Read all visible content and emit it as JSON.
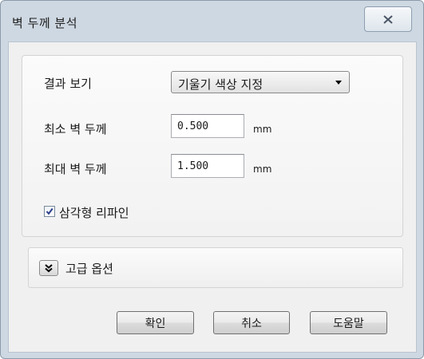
{
  "window": {
    "title": "벽 두께 분석"
  },
  "icons": {
    "close": "close-icon",
    "dropdown": "chevron-down-icon",
    "expander": "double-chevron-down-icon",
    "check": "checkmark-icon"
  },
  "form": {
    "view_result_label": "결과 보기",
    "view_result_selected": "기울기 색상 지정",
    "min_thickness_label": "최소 벽 두께",
    "min_thickness_value": "0.500",
    "min_thickness_unit": "mm",
    "max_thickness_label": "최대 벽 두께",
    "max_thickness_value": "1.500",
    "max_thickness_unit": "mm",
    "triangle_refine_label": "삼각형 리파인",
    "triangle_refine_checked": true
  },
  "advanced": {
    "label": "고급 옵션"
  },
  "buttons": {
    "ok": "확인",
    "cancel": "취소",
    "help": "도움말"
  },
  "colors": {
    "frame": "#ced8e2",
    "client": "#f0f0f0",
    "check": "#2a3f8a"
  }
}
